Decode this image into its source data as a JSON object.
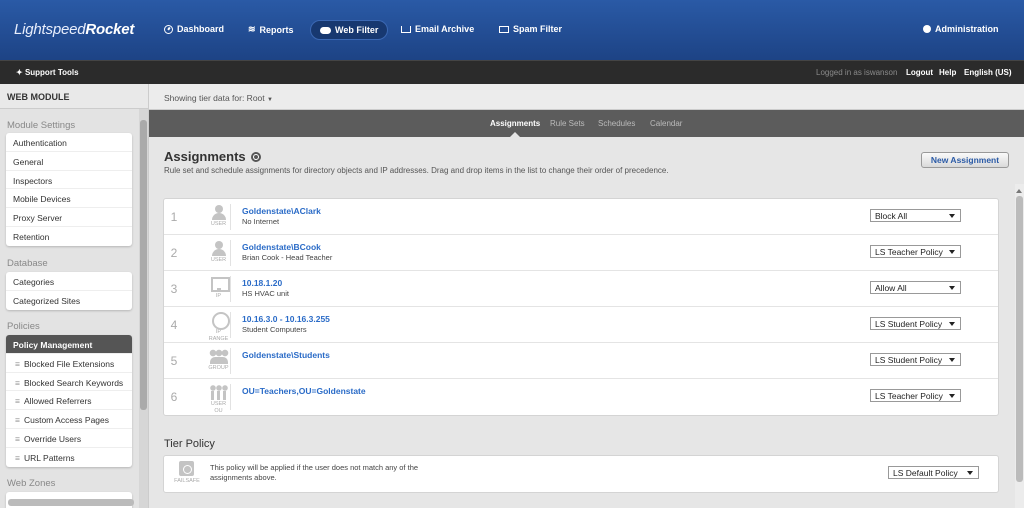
{
  "app": {
    "logo_light": "Lightspeed",
    "logo_bold": "Rocket"
  },
  "topnav": {
    "items": [
      {
        "label": "Dashboard",
        "icon": "dashboard-icon"
      },
      {
        "label": "Reports",
        "icon": "reports-icon"
      },
      {
        "label": "Web Filter",
        "icon": "cloud-icon",
        "active": true
      },
      {
        "label": "Email Archive",
        "icon": "archive-icon"
      },
      {
        "label": "Spam Filter",
        "icon": "mail-icon"
      }
    ],
    "admin_label": "Administration"
  },
  "subbar": {
    "support_tools": "Support Tools",
    "logged_in": "Logged in as iswanson",
    "logout": "Logout",
    "help": "Help",
    "language": "English (US)"
  },
  "sidebar": {
    "header": "WEB MODULE",
    "sections": [
      {
        "title": "Module Settings",
        "items": [
          "Authentication",
          "General",
          "Inspectors",
          "Mobile Devices",
          "Proxy Server",
          "Retention"
        ]
      },
      {
        "title": "Database",
        "items": [
          "Categories",
          "Categorized Sites"
        ]
      },
      {
        "title": "Policies",
        "active_item": "Policy Management",
        "items": [
          "Blocked File Extensions",
          "Blocked Search Keywords",
          "Allowed Referrers",
          "Custom Access Pages",
          "Override Users",
          "URL Patterns"
        ]
      },
      {
        "title": "Web Zones",
        "items": []
      }
    ]
  },
  "tierbar": {
    "text": "Showing tier data for: Root"
  },
  "tabs": [
    "Assignments",
    "Rule Sets",
    "Schedules",
    "Calendar"
  ],
  "main": {
    "title": "Assignments",
    "description": "Rule set and schedule assignments for directory objects and IP addresses. Drag and drop items in the list to change their order of precedence.",
    "new_button": "New Assignment",
    "rows": [
      {
        "num": "1",
        "type": "USER",
        "icon": "user-icon",
        "name": "Goldenstate\\AClark",
        "sub": "No Internet",
        "policy": "Block All"
      },
      {
        "num": "2",
        "type": "USER",
        "icon": "user-icon",
        "name": "Goldenstate\\BCook",
        "sub": "Brian Cook - Head Teacher",
        "policy": "LS Teacher Policy"
      },
      {
        "num": "3",
        "type": "IP",
        "icon": "monitor-icon",
        "name": "10.18.1.20",
        "sub": "HS HVAC unit",
        "policy": "Allow All"
      },
      {
        "num": "4",
        "type": "IP RANGE",
        "icon": "globe-icon",
        "name": "10.16.3.0 - 10.16.3.255",
        "sub": "Student Computers",
        "policy": "LS Student Policy"
      },
      {
        "num": "5",
        "type": "GROUP",
        "icon": "group-icon",
        "name": "Goldenstate\\Students",
        "sub": "",
        "policy": "LS Student Policy"
      },
      {
        "num": "6",
        "type": "USER OU",
        "icon": "org-unit-icon",
        "name": "OU=Teachers,OU=Goldenstate",
        "sub": "",
        "policy": "LS Teacher Policy"
      }
    ],
    "tier_policy": {
      "title": "Tier Policy",
      "icon_label": "FAILSAFE",
      "description": "This policy will be applied if the user does not match any of the assignments above.",
      "policy": "LS Default Policy"
    }
  },
  "colors": {
    "nav": "#1d4385",
    "link": "#2a6bc7",
    "active_menu": "#555555"
  }
}
